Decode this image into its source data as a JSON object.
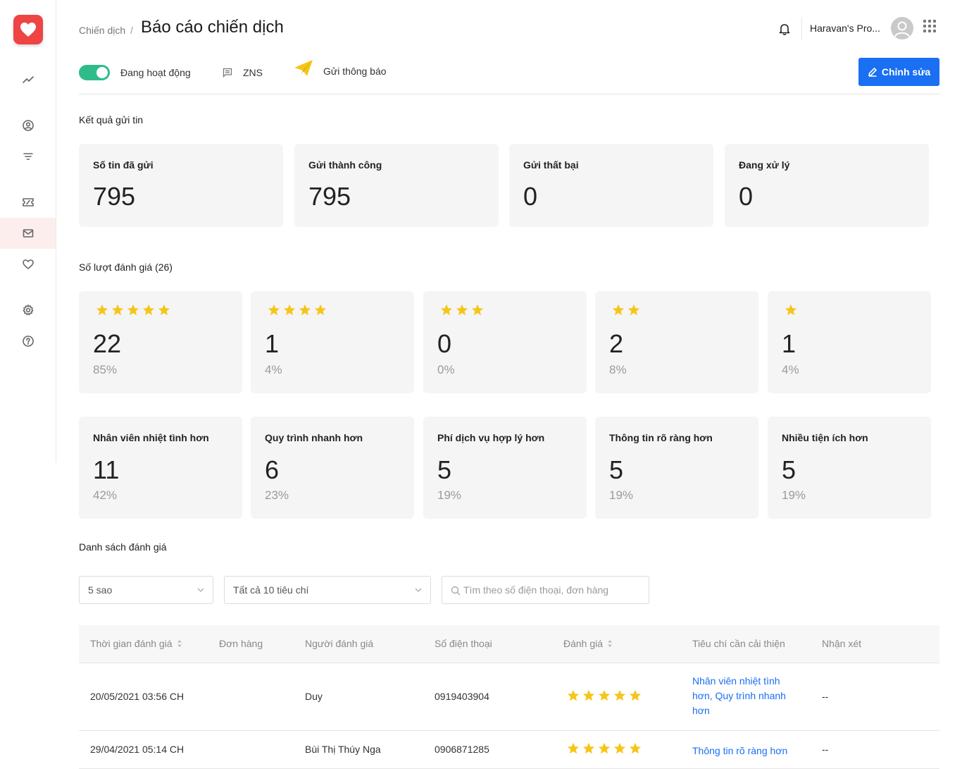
{
  "app": {
    "brand_color": "#ef4444",
    "accent_color": "#1a6ff2",
    "star_color": "#f5c518",
    "active_color": "#2ebd8a"
  },
  "sidebar": {
    "items": [
      {
        "icon": "trend-icon",
        "active": false
      },
      {
        "icon": "user-circle-icon",
        "active": false
      },
      {
        "icon": "filter-icon",
        "active": false
      },
      {
        "icon": "coupon-icon",
        "active": false
      },
      {
        "icon": "mail-icon",
        "active": true
      },
      {
        "icon": "heart-icon",
        "active": false
      },
      {
        "icon": "gear-icon",
        "active": false
      },
      {
        "icon": "help-icon",
        "active": false
      }
    ]
  },
  "header": {
    "breadcrumb_parent": "Chiến dịch",
    "breadcrumb_separator": "/",
    "title": "Báo cáo chiến dịch",
    "store_name": "Haravan's Pro..."
  },
  "status": {
    "active_label": "Đang hoạt động",
    "channel_label": "ZNS",
    "type_label": "Gửi thông báo",
    "edit_label": "Chỉnh sửa"
  },
  "send_results": {
    "title": "Kết quả gửi tin",
    "cards": [
      {
        "label": "Số tin đã gửi",
        "value": "795"
      },
      {
        "label": "Gửi thành công",
        "value": "795"
      },
      {
        "label": "Gửi thất bại",
        "value": "0"
      },
      {
        "label": "Đang xử lý",
        "value": "0"
      }
    ]
  },
  "ratings": {
    "title": "Số lượt đánh giá (26)",
    "cards": [
      {
        "stars": 5,
        "value": "22",
        "percent": "85%"
      },
      {
        "stars": 4,
        "value": "1",
        "percent": "4%"
      },
      {
        "stars": 3,
        "value": "0",
        "percent": "0%"
      },
      {
        "stars": 2,
        "value": "2",
        "percent": "8%"
      },
      {
        "stars": 1,
        "value": "1",
        "percent": "4%"
      }
    ]
  },
  "criteria": {
    "cards": [
      {
        "label": "Nhân viên nhiệt tình hơn",
        "value": "11",
        "percent": "42%"
      },
      {
        "label": "Quy trình nhanh hơn",
        "value": "6",
        "percent": "23%"
      },
      {
        "label": "Phí dịch vụ hợp lý hơn",
        "value": "5",
        "percent": "19%"
      },
      {
        "label": "Thông tin rõ ràng hơn",
        "value": "5",
        "percent": "19%"
      },
      {
        "label": "Nhiều tiện ích hơn",
        "value": "5",
        "percent": "19%"
      }
    ]
  },
  "review_list": {
    "title": "Danh sách đánh giá",
    "filter_stars": "5 sao",
    "filter_criteria": "Tất cả 10 tiêu chí",
    "search_placeholder": "Tìm theo số điện thoại, đơn hàng",
    "columns": [
      "Thời gian đánh giá",
      "Đơn hàng",
      "Người đánh giá",
      "Số điện thoại",
      "Đánh giá",
      "Tiêu chí cần cải thiện",
      "Nhận xét"
    ],
    "rows": [
      {
        "time": "20/05/2021 03:56 CH",
        "order": "",
        "reviewer": "Duy",
        "phone": "0919403904",
        "rating": 5,
        "criteria": "Nhân viên nhiệt tình hơn, Quy trình nhanh hơn",
        "comment": "--"
      },
      {
        "time": "29/04/2021 05:14 CH",
        "order": "",
        "reviewer": "Bùi Thị Thúy Nga",
        "phone": "0906871285",
        "rating": 5,
        "criteria": "Thông tin rõ ràng hơn",
        "comment": "--"
      }
    ]
  }
}
